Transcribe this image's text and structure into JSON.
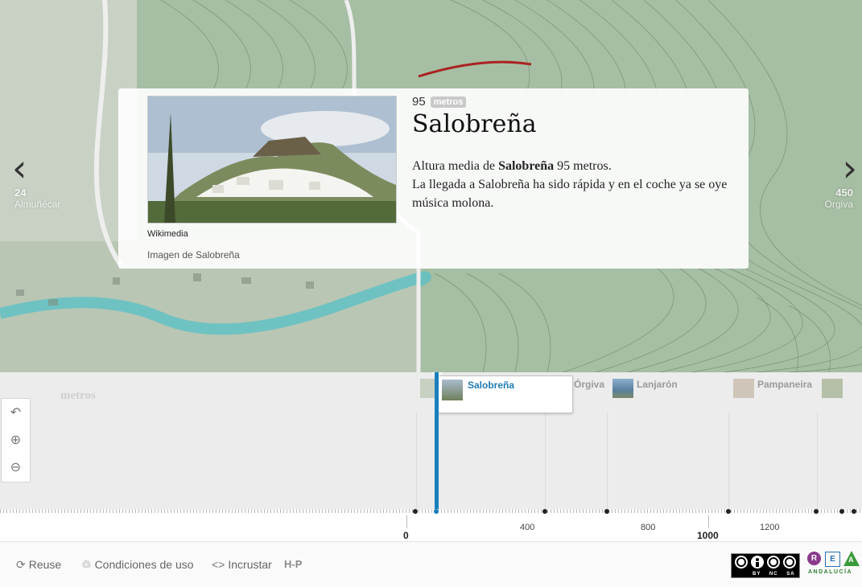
{
  "nav": {
    "prev": {
      "number": "24",
      "label": "Almuñécar"
    },
    "next": {
      "number": "450",
      "label": "Órgiva"
    }
  },
  "slide": {
    "value": "95",
    "unit": "metros",
    "title": "Salobreña",
    "desc_prefix": "Altura media de ",
    "desc_bold": "Salobreña",
    "desc_suffix": " 95 metros.",
    "desc_line2": "La llegada a Salobreña ha sido rápida y en el coche ya se oye música molona.",
    "credit": "Wikimedia",
    "caption": "Imagen de Salobreña"
  },
  "timeline": {
    "era_label": "metros",
    "active_marker": "Salobreña",
    "markers": [
      "Órgiva",
      "Lanjarón",
      "Pampaneira"
    ]
  },
  "axis": {
    "major": [
      "0",
      "1000"
    ],
    "minor": [
      "400",
      "800",
      "1200"
    ]
  },
  "footer": {
    "reuse": "Reuse",
    "conditions": "Condiciones de uso",
    "embed": "Incrustar",
    "h5p": "H-P",
    "cc_labels": [
      "BY",
      "NC",
      "SA"
    ],
    "rea_letters": [
      "R",
      "E",
      "A"
    ],
    "rea_text": "ANDALUCÍA"
  },
  "icons": {
    "prev": "chevron-left-icon",
    "next": "chevron-right-icon",
    "back": "back-arrow-icon",
    "zoom_in": "zoom-in-icon",
    "zoom_out": "zoom-out-icon",
    "reuse": "refresh-icon",
    "conditions": "handshake-icon",
    "embed": "code-icon"
  },
  "colors": {
    "accent": "#1a80bd",
    "map": "#9db79c"
  }
}
